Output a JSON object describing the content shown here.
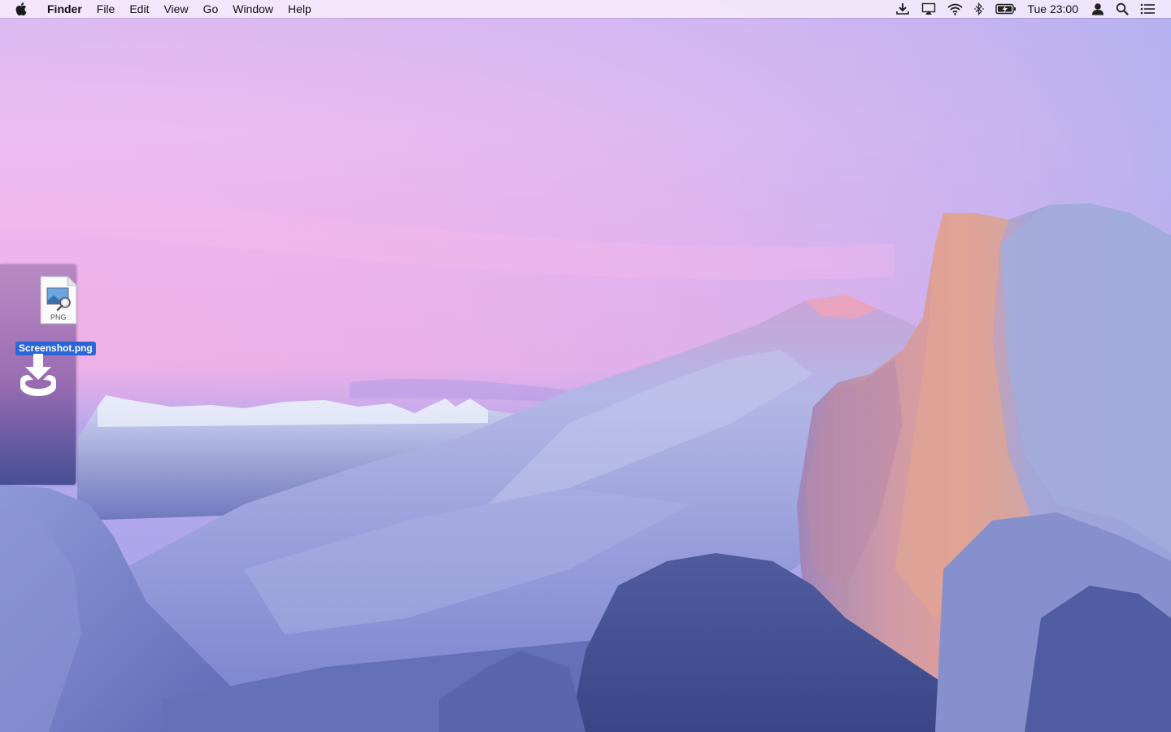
{
  "menubar": {
    "apple_icon": "apple-logo-icon",
    "app_name": "Finder",
    "menus": [
      "File",
      "Edit",
      "View",
      "Go",
      "Window",
      "Help"
    ],
    "status_icons": [
      "download-icon",
      "airplay-icon",
      "wifi-icon",
      "bluetooth-icon",
      "battery-charging-icon"
    ],
    "clock": "Tue 23:00",
    "right_icons": [
      "user-icon",
      "spotlight-search-icon",
      "notification-center-icon"
    ]
  },
  "drop_panel": {
    "file": {
      "name": "Screenshot.png",
      "badge": "PNG",
      "icon": "png-file-icon",
      "selected": true
    },
    "drop_target_icon": "download-tray-icon"
  },
  "desktop": {
    "wallpaper": "yosemite-half-dome-wallpaper",
    "colors": {
      "sky_top": "#c6b4f0",
      "sky_pink": "#f2b6ea",
      "mountains": "#7e88cc",
      "half_dome": "#c98a9a",
      "selection": "#2b66d9"
    }
  }
}
